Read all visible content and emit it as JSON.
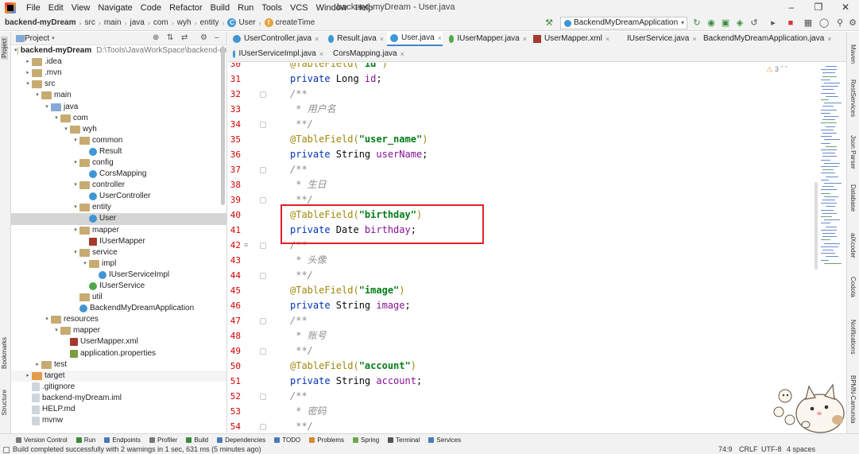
{
  "menubar": {
    "items": [
      "File",
      "Edit",
      "View",
      "Navigate",
      "Code",
      "Refactor",
      "Build",
      "Run",
      "Tools",
      "VCS",
      "Window",
      "Help"
    ],
    "title": "backend-myDream - User.java"
  },
  "navbar": {
    "project": "backend-myDream",
    "crumbs": [
      "src",
      "main",
      "java",
      "com",
      "wyh",
      "entity"
    ],
    "class_name": "User",
    "method_name": "createTime",
    "run_config": "BackendMyDreamApplication"
  },
  "project_panel": {
    "header": "Project",
    "tree": [
      {
        "label": "backend-myDream",
        "hint": "D:\\Tools\\JavaWorkSpace\\backend-m",
        "indent": 0,
        "arrow": "down",
        "icon": "folder"
      },
      {
        "label": ".idea",
        "indent": 1,
        "arrow": "right",
        "icon": "folder"
      },
      {
        "label": ".mvn",
        "indent": 1,
        "arrow": "right",
        "icon": "folder"
      },
      {
        "label": "src",
        "indent": 1,
        "arrow": "down",
        "icon": "folder"
      },
      {
        "label": "main",
        "indent": 2,
        "arrow": "down",
        "icon": "folder"
      },
      {
        "label": "java",
        "indent": 3,
        "arrow": "down",
        "icon": "folder-blue"
      },
      {
        "label": "com",
        "indent": 4,
        "arrow": "down",
        "icon": "folder"
      },
      {
        "label": "wyh",
        "indent": 5,
        "arrow": "down",
        "icon": "folder"
      },
      {
        "label": "common",
        "indent": 6,
        "arrow": "down",
        "icon": "folder"
      },
      {
        "label": "Result",
        "indent": 7,
        "arrow": "",
        "icon": "javaclass"
      },
      {
        "label": "config",
        "indent": 6,
        "arrow": "down",
        "icon": "folder"
      },
      {
        "label": "CorsMapping",
        "indent": 7,
        "arrow": "",
        "icon": "javaclass"
      },
      {
        "label": "controller",
        "indent": 6,
        "arrow": "down",
        "icon": "folder"
      },
      {
        "label": "UserController",
        "indent": 7,
        "arrow": "",
        "icon": "javaclass"
      },
      {
        "label": "entity",
        "indent": 6,
        "arrow": "down",
        "icon": "folder"
      },
      {
        "label": "User",
        "indent": 7,
        "arrow": "",
        "icon": "javaclass",
        "selected": true
      },
      {
        "label": "mapper",
        "indent": 6,
        "arrow": "down",
        "icon": "folder"
      },
      {
        "label": "IUserMapper",
        "indent": 7,
        "arrow": "",
        "icon": "xml"
      },
      {
        "label": "service",
        "indent": 6,
        "arrow": "down",
        "icon": "folder"
      },
      {
        "label": "impl",
        "indent": 7,
        "arrow": "down",
        "icon": "folder"
      },
      {
        "label": "IUserServiceImpl",
        "indent": 8,
        "arrow": "",
        "icon": "javaclass"
      },
      {
        "label": "IUserService",
        "indent": 7,
        "arrow": "",
        "icon": "javaiface"
      },
      {
        "label": "util",
        "indent": 6,
        "arrow": "",
        "icon": "folder"
      },
      {
        "label": "BackendMyDreamApplication",
        "indent": 6,
        "arrow": "",
        "icon": "javaclass"
      },
      {
        "label": "resources",
        "indent": 3,
        "arrow": "down",
        "icon": "folder"
      },
      {
        "label": "mapper",
        "indent": 4,
        "arrow": "down",
        "icon": "folder"
      },
      {
        "label": "UserMapper.xml",
        "indent": 5,
        "arrow": "",
        "icon": "xml"
      },
      {
        "label": "application.properties",
        "indent": 5,
        "arrow": "",
        "icon": "props"
      },
      {
        "label": "test",
        "indent": 2,
        "arrow": "right",
        "icon": "folder"
      },
      {
        "label": "target",
        "indent": 1,
        "arrow": "right",
        "icon": "folder-orange",
        "hover": true
      },
      {
        "label": ".gitignore",
        "indent": 1,
        "arrow": "",
        "icon": "file"
      },
      {
        "label": "backend-myDream.iml",
        "indent": 1,
        "arrow": "",
        "icon": "file"
      },
      {
        "label": "HELP.md",
        "indent": 1,
        "arrow": "",
        "icon": "file"
      },
      {
        "label": "mvnw",
        "indent": 1,
        "arrow": "",
        "icon": "file"
      }
    ]
  },
  "editor_tabs": {
    "row1": [
      {
        "label": "UserController.java",
        "icon": "javaclass"
      },
      {
        "label": "Result.java",
        "icon": "javaclass"
      },
      {
        "label": "User.java",
        "icon": "javaclass",
        "active": true
      },
      {
        "label": "IUserMapper.java",
        "icon": "javaiface"
      },
      {
        "label": "UserMapper.xml",
        "icon": "xml"
      },
      {
        "label": "IUserService.java",
        "icon": "javaiface"
      },
      {
        "label": "BackendMyDreamApplication.java",
        "icon": "javaclass"
      }
    ],
    "row2": [
      {
        "label": "IUserServiceImpl.java",
        "icon": "javaclass"
      },
      {
        "label": "CorsMapping.java",
        "icon": "javaclass"
      }
    ]
  },
  "editor": {
    "inspections": "3",
    "lines": [
      {
        "n": "30",
        "parts": [
          {
            "t": "@TableField(",
            "c": "annot"
          },
          {
            "t": "\"id\"",
            "c": "str"
          },
          {
            "t": ")",
            "c": "annot"
          }
        ]
      },
      {
        "n": "31",
        "parts": [
          {
            "t": "private ",
            "c": "kw"
          },
          {
            "t": "Long ",
            "c": "plain"
          },
          {
            "t": "id",
            "c": "ident"
          },
          {
            "t": ";",
            "c": "plain"
          }
        ]
      },
      {
        "n": "32",
        "parts": [
          {
            "t": "/**",
            "c": "doc"
          }
        ]
      },
      {
        "n": "33",
        "parts": [
          {
            "t": " * 用户名",
            "c": "doc"
          }
        ]
      },
      {
        "n": "34",
        "parts": [
          {
            "t": " **/",
            "c": "doc"
          }
        ]
      },
      {
        "n": "35",
        "parts": [
          {
            "t": "@TableField(",
            "c": "annot"
          },
          {
            "t": "\"user_name\"",
            "c": "str"
          },
          {
            "t": ")",
            "c": "annot"
          }
        ]
      },
      {
        "n": "36",
        "parts": [
          {
            "t": "private ",
            "c": "kw"
          },
          {
            "t": "String ",
            "c": "plain"
          },
          {
            "t": "userName",
            "c": "ident"
          },
          {
            "t": ";",
            "c": "plain"
          }
        ]
      },
      {
        "n": "37",
        "parts": [
          {
            "t": "/**",
            "c": "doc"
          }
        ]
      },
      {
        "n": "38",
        "parts": [
          {
            "t": " * 生日",
            "c": "doc"
          }
        ]
      },
      {
        "n": "39",
        "parts": [
          {
            "t": " **/",
            "c": "doc"
          }
        ]
      },
      {
        "n": "40",
        "parts": [
          {
            "t": "@TableField(",
            "c": "annot"
          },
          {
            "t": "\"birthday\"",
            "c": "str"
          },
          {
            "t": ")",
            "c": "annot"
          }
        ]
      },
      {
        "n": "41",
        "parts": [
          {
            "t": "private ",
            "c": "kw"
          },
          {
            "t": "Date ",
            "c": "plain"
          },
          {
            "t": "birthday",
            "c": "ident"
          },
          {
            "t": ";",
            "c": "plain"
          }
        ]
      },
      {
        "n": "42",
        "parts": [
          {
            "t": "/**",
            "c": "doc"
          }
        ]
      },
      {
        "n": "43",
        "parts": [
          {
            "t": " * 头像",
            "c": "doc"
          }
        ]
      },
      {
        "n": "44",
        "parts": [
          {
            "t": " **/",
            "c": "doc"
          }
        ]
      },
      {
        "n": "45",
        "parts": [
          {
            "t": "@TableField(",
            "c": "annot"
          },
          {
            "t": "\"image\"",
            "c": "str"
          },
          {
            "t": ")",
            "c": "annot"
          }
        ]
      },
      {
        "n": "46",
        "parts": [
          {
            "t": "private ",
            "c": "kw"
          },
          {
            "t": "String ",
            "c": "plain"
          },
          {
            "t": "image",
            "c": "ident"
          },
          {
            "t": ";",
            "c": "plain"
          }
        ]
      },
      {
        "n": "47",
        "parts": [
          {
            "t": "/**",
            "c": "doc"
          }
        ]
      },
      {
        "n": "48",
        "parts": [
          {
            "t": " * 账号",
            "c": "doc"
          }
        ]
      },
      {
        "n": "49",
        "parts": [
          {
            "t": " **/",
            "c": "doc"
          }
        ]
      },
      {
        "n": "50",
        "parts": [
          {
            "t": "@TableField(",
            "c": "annot"
          },
          {
            "t": "\"account\"",
            "c": "str"
          },
          {
            "t": ")",
            "c": "annot"
          }
        ]
      },
      {
        "n": "51",
        "parts": [
          {
            "t": "private ",
            "c": "kw"
          },
          {
            "t": "String ",
            "c": "plain"
          },
          {
            "t": "account",
            "c": "ident"
          },
          {
            "t": ";",
            "c": "plain"
          }
        ]
      },
      {
        "n": "52",
        "parts": [
          {
            "t": "/**",
            "c": "doc"
          }
        ]
      },
      {
        "n": "53",
        "parts": [
          {
            "t": " * 密码",
            "c": "doc"
          }
        ]
      },
      {
        "n": "54",
        "parts": [
          {
            "t": " **/",
            "c": "doc"
          }
        ]
      }
    ]
  },
  "left_stripe": {
    "project": "Project",
    "bookmarks": "Bookmarks",
    "structure": "Structure"
  },
  "right_stripe": [
    "Maven",
    "RestServices",
    "Json Parser",
    "Database",
    "aiXcoder",
    "Codota",
    "Notifications",
    "BPMN-Camunda"
  ],
  "bottom_tools": [
    "Version Control",
    "Run",
    "Endpoints",
    "Profiler",
    "Build",
    "Dependencies",
    "TODO",
    "Problems",
    "Spring",
    "Terminal",
    "Services"
  ],
  "statusbar": {
    "message": "Build completed successfully with 2 warnings in 1 sec, 631 ms (5 minutes ago)",
    "position": "74:9",
    "line_sep": "CRLF",
    "encoding": "UTF-8",
    "indent": "4 spaces"
  },
  "colors": {
    "accent": "#4083c9",
    "highlight_box": "#e0202a",
    "line_number": "#d20000",
    "annotation": "#9e880d",
    "string": "#067d17",
    "keyword": "#0033b3",
    "field": "#871094",
    "doc_comment": "#8c8c8c"
  }
}
